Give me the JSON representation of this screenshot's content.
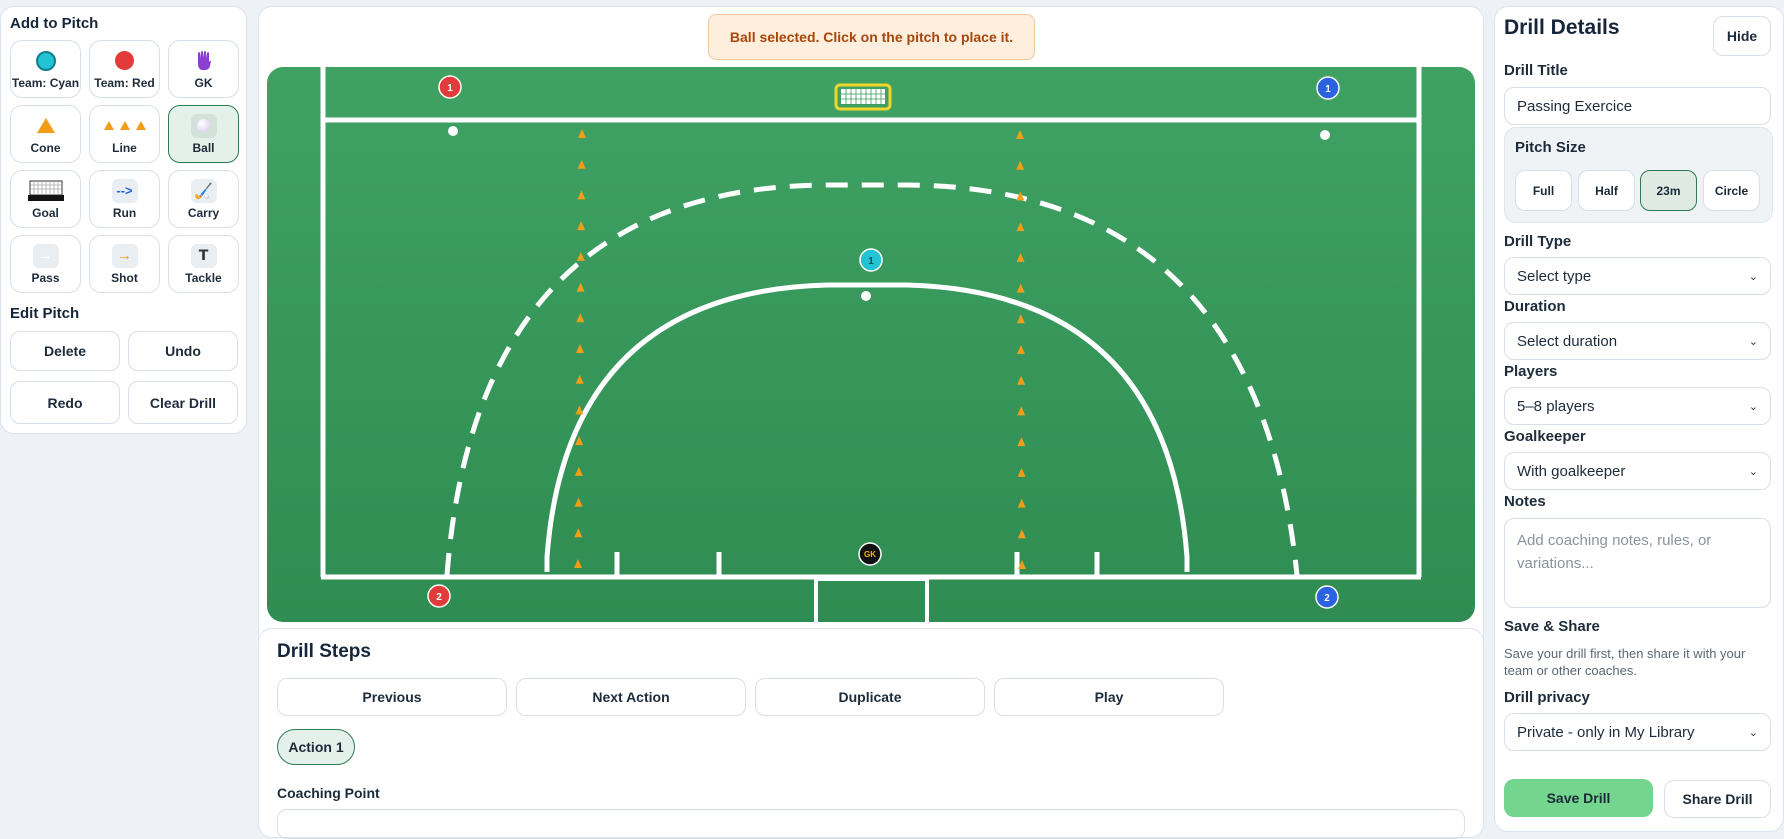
{
  "left_panel": {
    "add_title": "Add to Pitch",
    "tools": [
      {
        "label": "Team: Cyan",
        "icon": "cyan-player-icon"
      },
      {
        "label": "Team: Red",
        "icon": "red-player-icon"
      },
      {
        "label": "GK",
        "icon": "goalkeeper-glove-icon"
      },
      {
        "label": "Cone",
        "icon": "cone-icon"
      },
      {
        "label": "Line",
        "icon": "cone-line-icon"
      },
      {
        "label": "Ball",
        "icon": "ball-icon"
      },
      {
        "label": "Goal",
        "icon": "goal-icon"
      },
      {
        "label": "Run",
        "icon": "run-arrow-icon"
      },
      {
        "label": "Carry",
        "icon": "carry-stick-icon"
      },
      {
        "label": "Pass",
        "icon": "pass-arrow-icon"
      },
      {
        "label": "Shot",
        "icon": "shot-arrow-icon"
      },
      {
        "label": "Tackle",
        "icon": "tackle-icon",
        "glyph": "T"
      }
    ],
    "active_tool": "Ball",
    "edit_title": "Edit Pitch",
    "edit_buttons": [
      "Delete",
      "Undo",
      "Redo",
      "Clear Drill"
    ]
  },
  "toast": "Ball selected. Click on the pitch to place it.",
  "pitch": {
    "players": [
      {
        "team": "red",
        "number": "1"
      },
      {
        "team": "blue",
        "number": "1"
      },
      {
        "team": "red",
        "number": "2"
      },
      {
        "team": "blue",
        "number": "2"
      },
      {
        "team": "cyan",
        "number": "1"
      },
      {
        "team": "gk",
        "number": "GK"
      }
    ]
  },
  "drill_steps": {
    "title": "Drill Steps",
    "buttons": [
      "Previous",
      "Next Action",
      "Duplicate",
      "Play"
    ],
    "active_action": "Action 1",
    "coaching_point_label": "Coaching Point"
  },
  "drill_details": {
    "title": "Drill Details",
    "hide_label": "Hide",
    "drill_title_label": "Drill Title",
    "drill_title_value": "Passing Exercice",
    "pitch_size_label": "Pitch Size",
    "pitch_sizes": [
      "Full",
      "Half",
      "23m",
      "Circle"
    ],
    "pitch_size_selected": "23m",
    "drill_type_label": "Drill Type",
    "drill_type_value": "Select type",
    "duration_label": "Duration",
    "duration_value": "Select duration",
    "players_label": "Players",
    "players_value": "5–8 players",
    "goalkeeper_label": "Goalkeeper",
    "goalkeeper_value": "With goalkeeper",
    "notes_label": "Notes",
    "notes_placeholder": "Add coaching notes, rules, or variations...",
    "save_share_label": "Save & Share",
    "save_share_help": "Save your drill first, then share it with your team or other coaches.",
    "privacy_label": "Drill privacy",
    "privacy_value": "Private - only in My Library",
    "save_label": "Save Drill",
    "share_label": "Share Drill"
  },
  "colors": {
    "pitch_green": "#3a9a5c",
    "cone_orange": "#f29d17",
    "team_red": "#e23b3b",
    "team_blue": "#2a62e0",
    "team_cyan": "#22c3d3",
    "accent_green": "#2f7a52"
  }
}
